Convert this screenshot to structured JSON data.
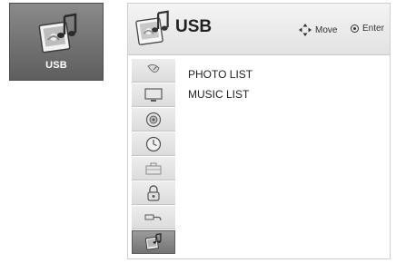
{
  "tile": {
    "label": "USB",
    "icon": "usb-photo-music-icon"
  },
  "header": {
    "title": "USB",
    "icon": "usb-photo-music-icon",
    "hints": [
      {
        "icon": "four-way-arrow-icon",
        "label": "Move"
      },
      {
        "icon": "ok-button-icon",
        "label": "Enter"
      }
    ]
  },
  "sidebar": {
    "items": [
      {
        "icon": "satellite-dish-icon",
        "name": "setup"
      },
      {
        "icon": "monitor-icon",
        "name": "picture"
      },
      {
        "icon": "speaker-icon",
        "name": "audio"
      },
      {
        "icon": "clock-icon",
        "name": "time"
      },
      {
        "icon": "toolbox-icon",
        "name": "option"
      },
      {
        "icon": "padlock-icon",
        "name": "lock"
      },
      {
        "icon": "cable-plug-icon",
        "name": "input"
      },
      {
        "icon": "usb-photo-music-icon",
        "name": "usb",
        "active": true
      }
    ]
  },
  "content": {
    "items": [
      "PHOTO LIST",
      "MUSIC LIST"
    ]
  }
}
